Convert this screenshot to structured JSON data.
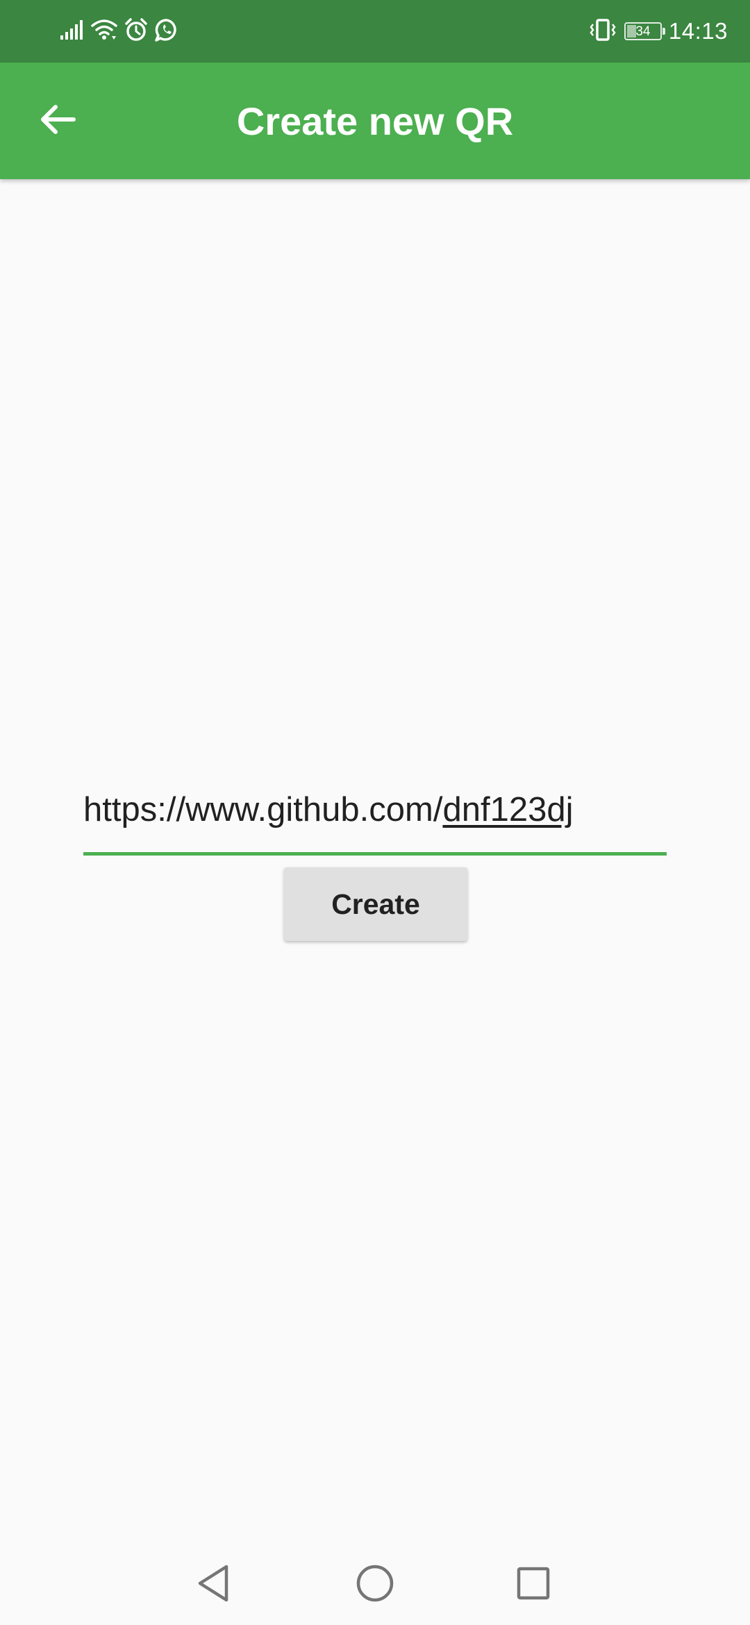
{
  "status_bar": {
    "time": "14:13",
    "battery_level": "34",
    "battery_fraction": 0.34,
    "left_icons": [
      "signal-icon",
      "wifi-icon",
      "alarm-icon",
      "whatsapp-icon"
    ],
    "right_icons": [
      "vibrate-icon",
      "battery-icon"
    ]
  },
  "app_bar": {
    "title": "Create new QR",
    "back_icon": "back-arrow-icon",
    "color": "#4caf50"
  },
  "form": {
    "url_prefix": "https://www.github.com/",
    "url_suffix": "dnf123dj",
    "create_label": "Create",
    "accent": "#4caf50"
  },
  "nav_bar": {
    "icons": [
      "back-triangle-icon",
      "home-circle-icon",
      "recents-square-icon"
    ]
  },
  "colors": {
    "status_bar": "#3b8640",
    "app_bar": "#4caf50",
    "background": "#fafafa",
    "button": "#e0e0e0"
  }
}
